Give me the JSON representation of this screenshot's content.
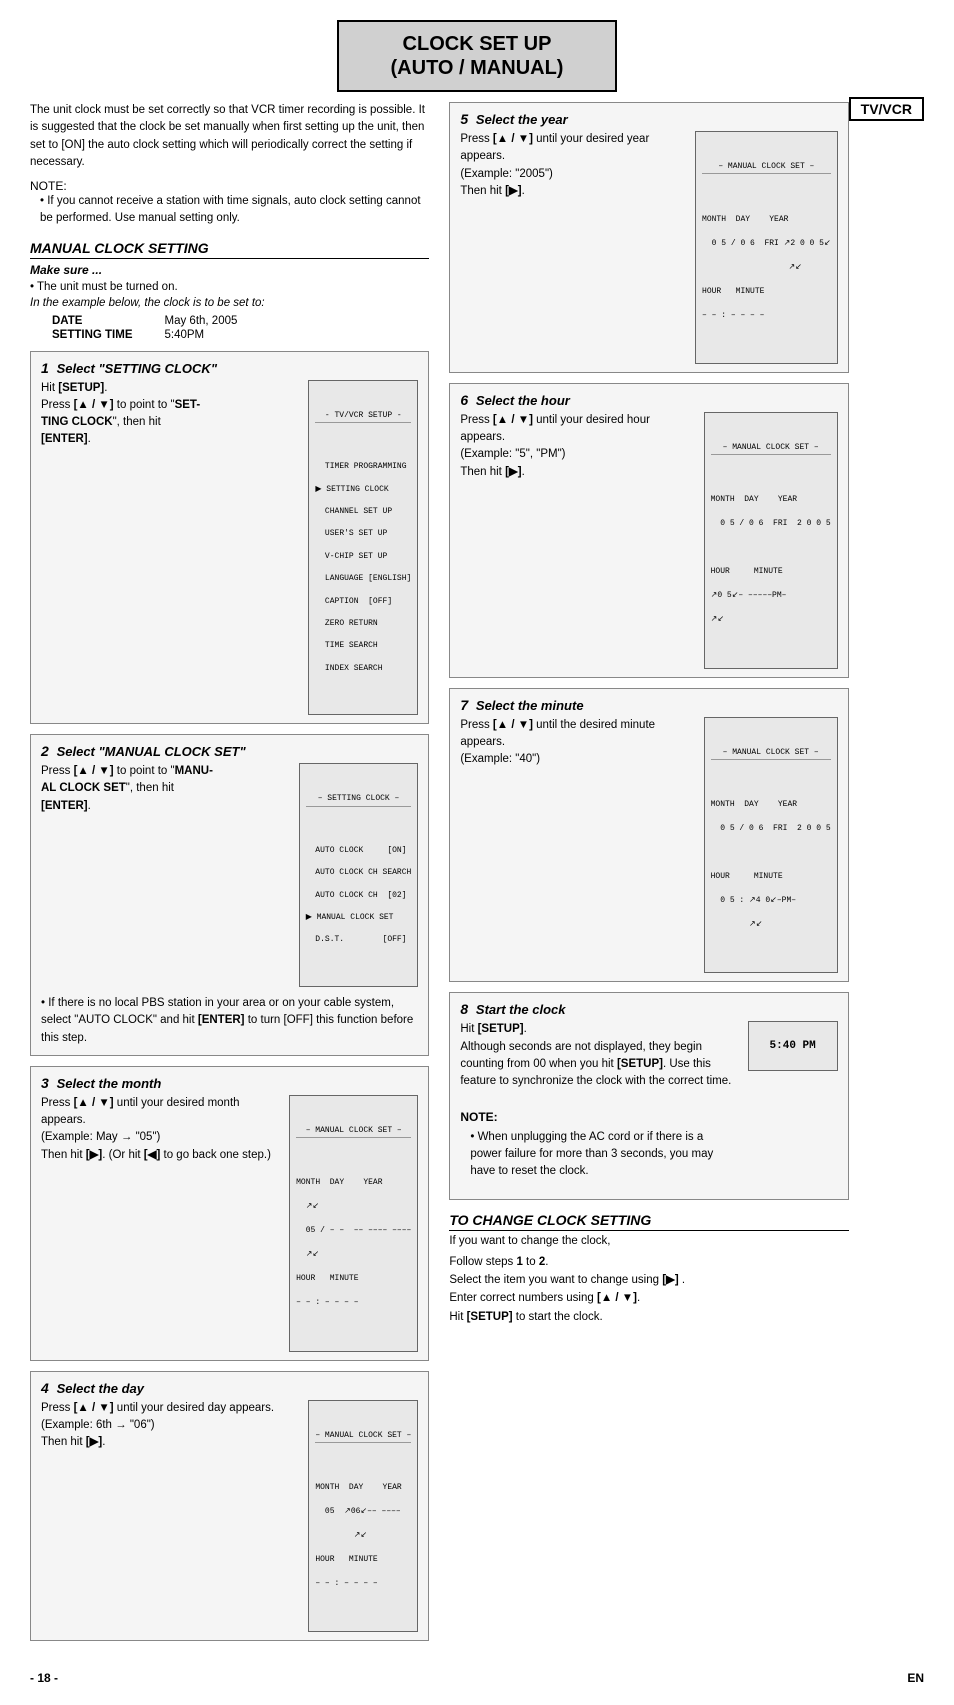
{
  "page": {
    "title_line1": "CLOCK SET UP",
    "title_line2": "(AUTO / MANUAL)",
    "tv_vcr_badge": "TV/VCR",
    "page_number": "- 18 -",
    "lang": "EN"
  },
  "intro": {
    "paragraph": "The unit clock must be set correctly so that VCR timer recording is possible. It is suggested that the clock be set manually when first setting up the unit, then set to [ON] the auto clock setting which will periodically correct the setting if necessary.",
    "note_label": "NOTE:",
    "note_bullet": "If you cannot receive a station with time signals, auto clock setting cannot be performed. Use manual setting only."
  },
  "manual_clock": {
    "section_title": "MANUAL CLOCK SETTING",
    "make_sure": "Make sure ...",
    "bullet1": "The unit must be turned on.",
    "italic_note": "In the example below, the clock is to be set to:",
    "date_label": "DATE",
    "date_value": "May 6th, 2005",
    "time_label": "SETTING TIME",
    "time_value": "5:40PM"
  },
  "steps": [
    {
      "number": "1",
      "title": "Select \"SETTING CLOCK\"",
      "text": "Hit [SETUP].\nPress [▲ / ▼] to point to \"SETTING CLOCK\", then hit [ENTER].",
      "lcd_title": "- TV/VCR SETUP -",
      "lcd_lines": [
        "TIMER PROGRAMMING",
        "SETTING CLOCK",
        "CHANNEL SET UP",
        "USER'S SET UP",
        "V-CHIP SET UP",
        "LANGUAGE [ENGLISH]",
        "CAPTION [OFF]",
        "ZERO RETURN",
        "TIME SEARCH",
        "INDEX SEARCH"
      ],
      "arrow_line": 2
    },
    {
      "number": "2",
      "title": "Select \"MANUAL CLOCK SET\"",
      "text": "Press [▲ / ▼] to point to \"MANUAL CLOCK SET\", then hit [ENTER].",
      "lcd_title": "- SETTING CLOCK -",
      "lcd_lines": [
        "AUTO CLOCK      [ON]",
        "AUTO CLOCK CH SEARCH",
        "AUTO CLOCK CH   [02]",
        "MANUAL CLOCK SET",
        "D.S.T.         [OFF]"
      ],
      "arrow_line": 4,
      "extra_bullet": "If there is no local PBS station in your area or on your cable system, select \"AUTO CLOCK\" and hit [ENTER] to turn [OFF] this function before this step."
    },
    {
      "number": "3",
      "title": "Select the month",
      "text": "Press [▲ / ▼] until your desired month appears.\n(Example: May → \"05\")\nThen hit [▶]. (Or hit [◀] to go back one step.)",
      "lcd_title": "– MANUAL CLOCK SET –",
      "lcd_content": "month_step3"
    },
    {
      "number": "4",
      "title": "Select the day",
      "text": "Press [▲ / ▼] until your desired day appears.\n(Example: 6th → \"06\")\nThen hit [▶].",
      "lcd_title": "– MANUAL CLOCK SET –",
      "lcd_content": "month_step4"
    },
    {
      "number": "5",
      "title": "Select the year",
      "text": "Press [▲ / ▼] until your desired year appears.\n(Example: \"2005\")\nThen hit [▶].",
      "lcd_title": "– MANUAL CLOCK SET –",
      "lcd_content": "year_step5"
    },
    {
      "number": "6",
      "title": "Select the hour",
      "text": "Press [▲ / ▼] until your desired hour appears.\n(Example: \"5\", \"PM\")\nThen hit [▶].",
      "lcd_title": "– MANUAL CLOCK SET –",
      "lcd_content": "hour_step6"
    },
    {
      "number": "7",
      "title": "Select the minute",
      "text": "Press [▲ / ▼] until the desired minute appears.\n(Example: \"40\")",
      "lcd_title": "– MANUAL CLOCK SET –",
      "lcd_content": "minute_step7"
    },
    {
      "number": "8",
      "title": "Start the clock",
      "text": "Hit [SETUP].\nAlthough seconds are not displayed, they begin counting from 00 when you hit [SETUP]. Use this feature to synchronize the clock with the correct time.",
      "lcd_content": "clock_step8",
      "note_label": "NOTE:",
      "note_bullet": "When unplugging the AC cord or if there is a power failure for more than 3 seconds, you may have to reset the clock."
    }
  ],
  "change_section": {
    "title": "TO CHANGE CLOCK SETTING",
    "intro": "If you want to change the clock,",
    "steps": [
      "1)Follow steps 1 to 2.",
      "2)Select the item you want to change using [▶] .",
      "3)Enter correct numbers using [▲ / ▼].",
      "4)Hit [SETUP] to start the clock."
    ]
  }
}
